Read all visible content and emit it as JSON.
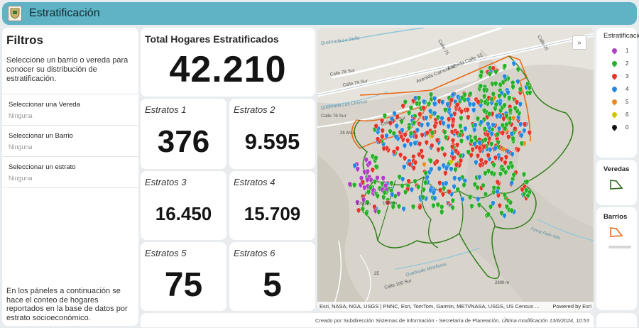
{
  "app": {
    "title": "Estratificación"
  },
  "filters": {
    "heading": "Filtros",
    "description": "Seleccione un barrio o vereda para conocer su distribución de estratificación.",
    "items": [
      {
        "label": "Seleccionar una Vereda",
        "value": "Ninguna"
      },
      {
        "label": "Seleccionar un Barrio",
        "value": "Ninguna"
      },
      {
        "label": "Seleccionar un estrato",
        "value": "Ninguna"
      }
    ],
    "footnote": "En los páneles a continuación se hace el conteo de hogares reportados en la base de datos por estrato socioeconómico."
  },
  "total": {
    "label": "Total Hogares Estratificados",
    "value": "42.210"
  },
  "strata_cards": [
    {
      "label": "Estratos 1",
      "value": "376"
    },
    {
      "label": "Estratos 2",
      "value": "9.595"
    },
    {
      "label": "Estratos 3",
      "value": "16.450"
    },
    {
      "label": "Estratos 4",
      "value": "15.709"
    },
    {
      "label": "Estratos 5",
      "value": "75"
    },
    {
      "label": "Estratos 6",
      "value": "5"
    }
  ],
  "map": {
    "attribution": "Esri, NASA, NGA, USGS | PNNC, Esri, TomTom, Garmin, METI/NASA, USGS, US Census ...",
    "powered_by": "Powered by Esri",
    "labels": [
      "Avenida Calle 31",
      "Avenida Carrera 42",
      "Calle 79 Sur",
      "Calle 78 Sur",
      "Calle 75",
      "Calle 25",
      "Calle 76 Sur",
      "Calle 77 Sur",
      "Calle 100 Sur",
      "Quebrada Miraflores",
      "Quebrada La Doña",
      "Quebrada Los Chorros",
      "Finca Palo Alto",
      "25 AN A",
      "1906 m",
      "25",
      "2300 m",
      "1700 m"
    ]
  },
  "legend": {
    "title": "Estratificacion",
    "items": [
      {
        "label": "1",
        "color": "#b03cc8"
      },
      {
        "label": "2",
        "color": "#27b027"
      },
      {
        "label": "3",
        "color": "#e5352a"
      },
      {
        "label": "4",
        "color": "#2389e0"
      },
      {
        "label": "5",
        "color": "#e88a1e"
      },
      {
        "label": "6",
        "color": "#d4c400"
      },
      {
        "label": "0",
        "color": "#111111"
      }
    ],
    "veredas_title": "Veredas",
    "veredas_color": "#2f6b1a",
    "barrios_title": "Barrios",
    "barrios_color": "#e86a1a"
  },
  "footer": {
    "text": "Creado por Subdirección Sistemas de Información - Secretaría de Planeación.",
    "modified": "Última modificación 13/6/2024, 10:53"
  }
}
